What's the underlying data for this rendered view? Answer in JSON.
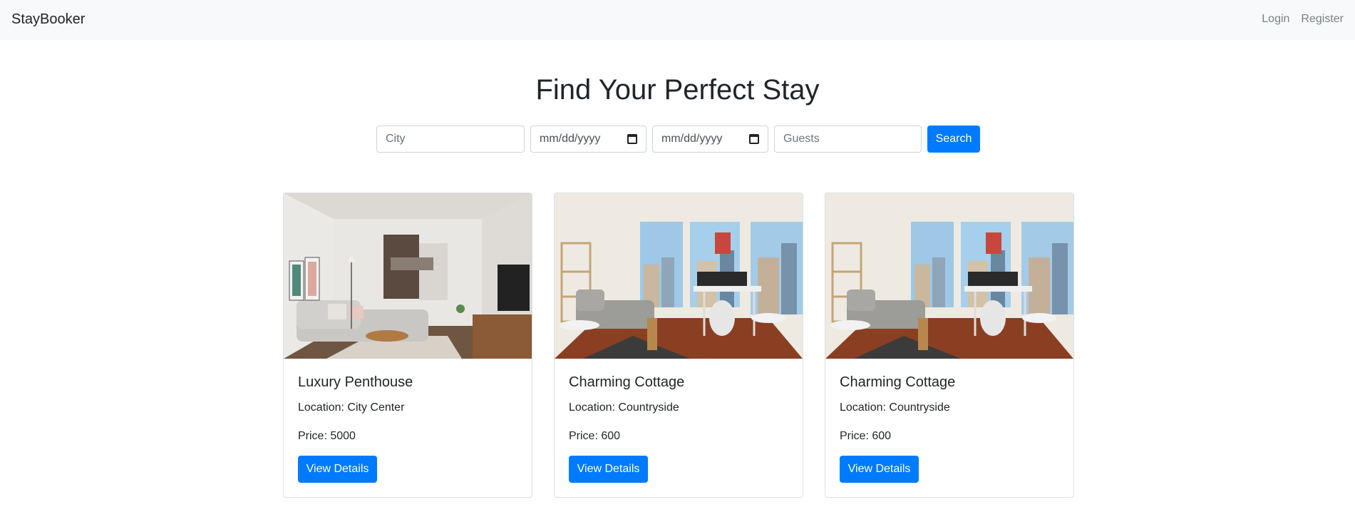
{
  "navbar": {
    "brand": "StayBooker",
    "links": [
      {
        "label": "Login"
      },
      {
        "label": "Register"
      }
    ]
  },
  "hero": {
    "title": "Find Your Perfect Stay"
  },
  "search": {
    "city_placeholder": "City",
    "checkin_value": "mm/dd/yyyy",
    "checkout_value": "mm/dd/yyyy",
    "guests_placeholder": "Guests",
    "button_label": "Search"
  },
  "listings": [
    {
      "title": "Luxury Penthouse",
      "location": "Location: City Center",
      "price": "Price: 5000",
      "button_label": "View Details",
      "image_icon": "living-room-photo"
    },
    {
      "title": "Charming Cottage",
      "location": "Location: Countryside",
      "price": "Price: 600",
      "button_label": "View Details",
      "image_icon": "office-living-room-photo"
    },
    {
      "title": "Charming Cottage",
      "location": "Location: Countryside",
      "price": "Price: 600",
      "button_label": "View Details",
      "image_icon": "office-living-room-photo"
    }
  ],
  "colors": {
    "primary": "#007bff",
    "navbar_bg": "#f8f9fa",
    "muted_link": "#7a7f84"
  }
}
